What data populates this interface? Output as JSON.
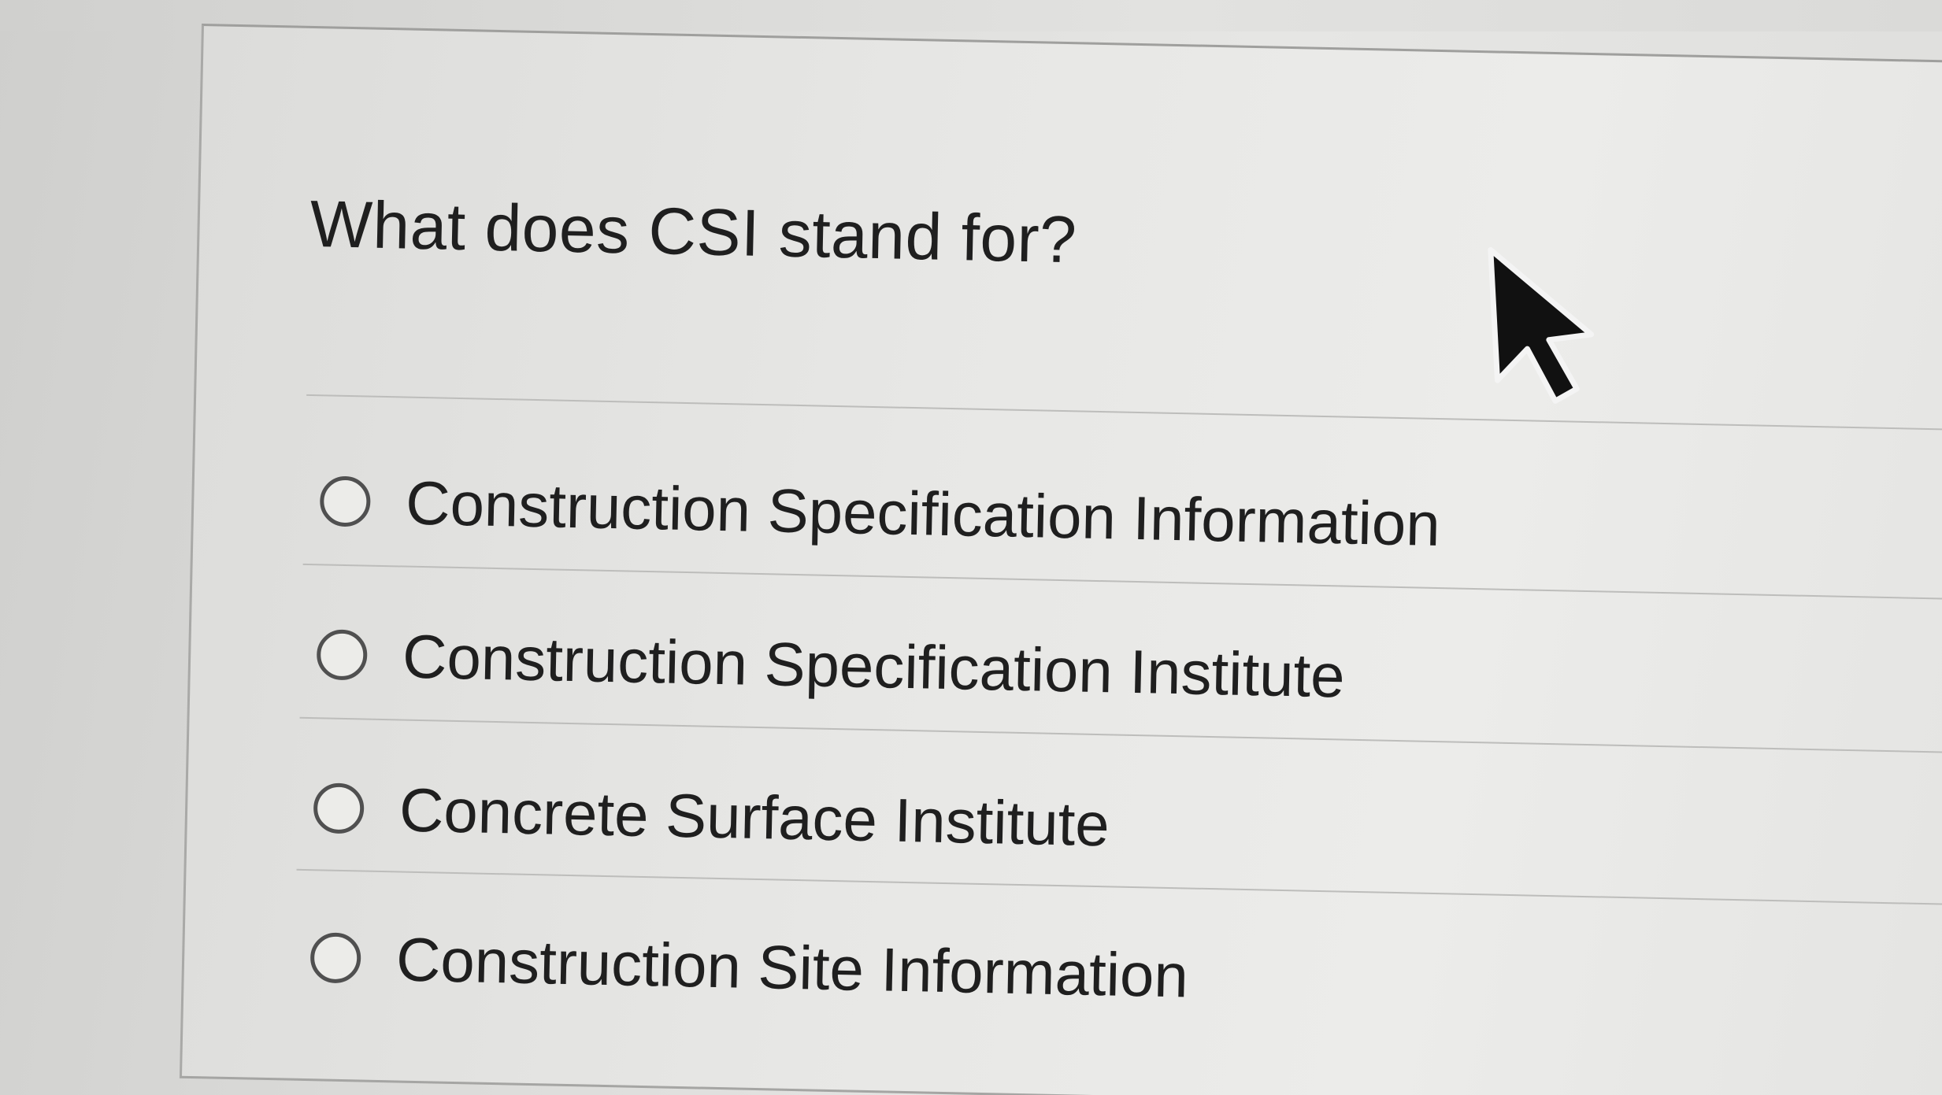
{
  "question": {
    "text": "What does CSI stand for?"
  },
  "answers": [
    {
      "label": "Construction Specification Information",
      "selected": false
    },
    {
      "label": "Construction Specification Institute",
      "selected": false
    },
    {
      "label": "Concrete Surface Institute",
      "selected": false
    },
    {
      "label": "Construction Site Information",
      "selected": false
    }
  ],
  "colors": {
    "text": "#1f1f1f",
    "radio_border": "#505050",
    "divider": "#bdbdbb",
    "cursor_fill": "#111111"
  },
  "icons": {
    "cursor": "mouse-pointer-icon",
    "radio": "radio-button-unchecked"
  }
}
